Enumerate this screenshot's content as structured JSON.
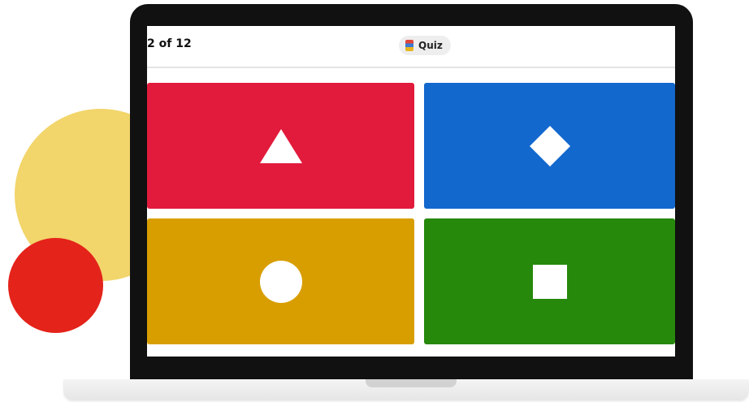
{
  "header": {
    "question_counter": "2 of 12",
    "quiz_label": "Quiz"
  },
  "answers": [
    {
      "shape": "triangle-icon",
      "color": "#e21b3c"
    },
    {
      "shape": "diamond-icon",
      "color": "#1368ce"
    },
    {
      "shape": "circle-icon",
      "color": "#d89e00"
    },
    {
      "shape": "square-icon",
      "color": "#26890c"
    }
  ],
  "decorations": {
    "yellow_circle": "#f2d56b",
    "red_circle": "#e4231a"
  }
}
